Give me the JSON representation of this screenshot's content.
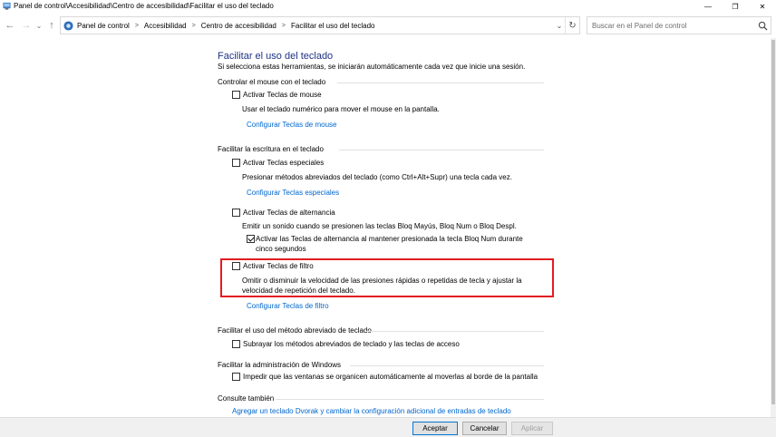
{
  "window": {
    "title": "Panel de control\\Accesibilidad\\Centro de accesibilidad\\Facilitar el uso del teclado",
    "minimize_glyph": "—",
    "maximize_glyph": "❐",
    "close_glyph": "✕"
  },
  "nav": {
    "back_glyph": "←",
    "forward_glyph": "→",
    "recent_glyph": "⌄",
    "up_glyph": "↑",
    "breadcrumbs": [
      "Panel de control",
      "Accesibilidad",
      "Centro de accesibilidad",
      "Facilitar el uso del teclado"
    ],
    "separator": ">",
    "dropdown_glyph": "⌄",
    "refresh_glyph": "↻"
  },
  "search": {
    "placeholder": "Buscar en el Panel de control"
  },
  "page": {
    "title": "Facilitar el uso del teclado",
    "intro": "Si selecciona estas herramientas, se iniciarán automáticamente cada vez que inicie una sesión.",
    "sections": {
      "mouse": {
        "heading": "Controlar el mouse con el teclado",
        "option": "Activar Teclas de mouse",
        "checked": false,
        "description": "Usar el teclado numérico para mover el mouse en la pantalla.",
        "link": "Configurar Teclas de mouse"
      },
      "typing": {
        "heading": "Facilitar la escritura en el teclado",
        "sticky_option": "Activar Teclas especiales",
        "sticky_checked": false,
        "sticky_description": "Presionar métodos abreviados del teclado (como Ctrl+Alt+Supr) una tecla cada vez.",
        "sticky_link": "Configurar Teclas especiales",
        "toggle_option": "Activar Teclas de alternancia",
        "toggle_checked": false,
        "toggle_description": "Emitir un sonido cuando se presionen las teclas Bloq Mayús, Bloq Num o Bloq Despl.",
        "toggle_sub_option": "Activar las Teclas de alternancia al mantener presionada la tecla Bloq Num durante cinco segundos",
        "toggle_sub_checked": true,
        "filter_option": "Activar Teclas de filtro",
        "filter_checked": false,
        "filter_description": "Omitir o disminuir la velocidad de las presiones rápidas o repetidas de tecla y ajustar la velocidad de repetición del teclado.",
        "filter_link": "Configurar Teclas de filtro"
      },
      "shortcuts": {
        "heading": "Facilitar el uso del método abreviado de teclado",
        "option": "Subrayar los métodos abreviados de teclado y las teclas de acceso",
        "checked": false
      },
      "windows": {
        "heading": "Facilitar la administración de Windows",
        "option": "Impedir que las ventanas se organicen automáticamente al moverlas al borde de la pantalla",
        "checked": false
      },
      "see_also": {
        "heading": "Consulte también",
        "link": "Agregar un teclado Dvorak y cambiar la configuración adicional de entradas de teclado"
      }
    }
  },
  "buttons": {
    "ok": "Aceptar",
    "cancel": "Cancelar",
    "apply": "Aplicar"
  },
  "colors": {
    "title_blue": "#1e3287",
    "link_blue": "#0066cc",
    "highlight_red": "#e31b23"
  }
}
